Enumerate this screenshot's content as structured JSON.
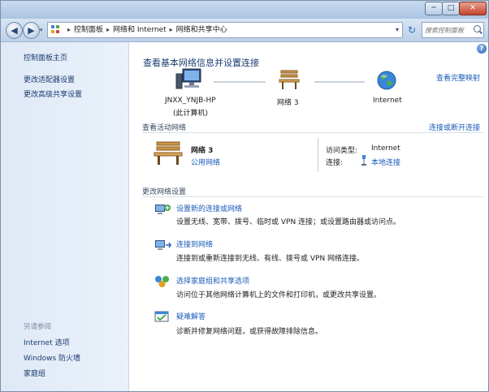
{
  "window": {
    "controls": {
      "minimize": "─",
      "maximize": "□",
      "close": "✕"
    }
  },
  "navigation": {
    "back_glyph": "◀",
    "forward_glyph": "▶",
    "recent_glyph": "▾",
    "breadcrumb": [
      "控制面板",
      "网络和 Internet",
      "网络和共享中心"
    ],
    "breadcrumb_separator": "▸",
    "dropdown_glyph": "▾",
    "refresh_glyph": "↻",
    "search_placeholder": "搜索控制面板"
  },
  "sidebar": {
    "top_links": [
      "控制面板主页",
      "更改适配器设置",
      "更改高级共享设置"
    ],
    "see_also_heading": "另请参阅",
    "see_also_links": [
      "Internet 选项",
      "Windows 防火墙",
      "家庭组"
    ]
  },
  "main": {
    "help_glyph": "?",
    "title": "查看基本网络信息并设置连接",
    "full_map_link": "查看完整映射",
    "map": {
      "computer_name": "JNXX_YNJB-HP",
      "computer_caption": "(此计算机)",
      "network_name": "网络  3",
      "internet_label": "Internet"
    },
    "active_networks": {
      "heading": "查看活动网络",
      "connect_link": "连接或断开连接",
      "network_name": "网络  3",
      "network_type": "公用网络",
      "access_type_label": "访问类型:",
      "access_type_value": "Internet",
      "connections_label": "连接:",
      "connections_value": "本地连接"
    },
    "change_settings": {
      "heading": "更改网络设置",
      "tasks": [
        {
          "icon": "new-connection-icon",
          "title": "设置新的连接或网络",
          "description": "设置无线、宽带、拨号、临时或 VPN 连接；或设置路由器或访问点。"
        },
        {
          "icon": "connect-network-icon",
          "title": "连接到网络",
          "description": "连接到或重新连接到无线、有线、拨号或 VPN 网络连接。"
        },
        {
          "icon": "homegroup-icon",
          "title": "选择家庭组和共享选项",
          "description": "访问位于其他网络计算机上的文件和打印机，或更改共享设置。"
        },
        {
          "icon": "troubleshoot-icon",
          "title": "疑难解答",
          "description": "诊断并修复网络问题，或获得故障排除信息。"
        }
      ]
    }
  },
  "colors": {
    "link": "#1a5bb8",
    "sidebar_bg": "#dfe9f6",
    "title_text": "#1a3b70"
  }
}
